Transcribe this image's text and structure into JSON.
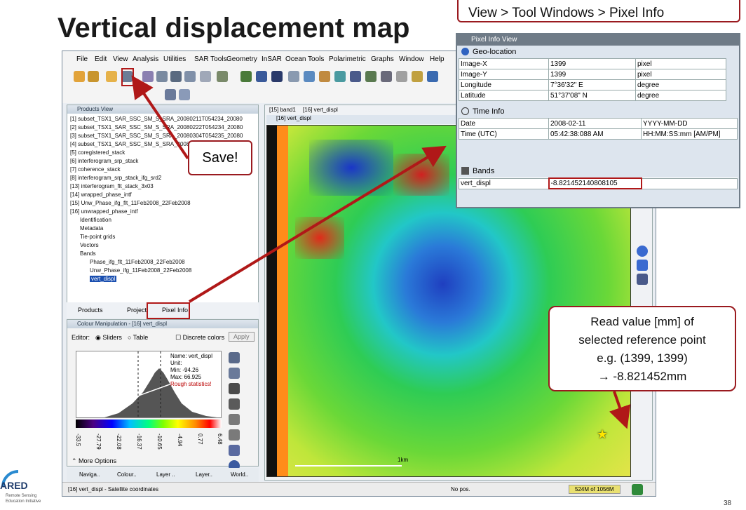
{
  "slide": {
    "title": "Vertical displacement map",
    "path_hint": "View > Tool Windows > Pixel Info",
    "save_callout": "Save!",
    "read_callout": [
      "Read value [mm] of",
      "selected reference point",
      "e.g. (1399, 1399)",
      "→ -8.821452mm"
    ],
    "page_number": "38",
    "logo_text": "ARED",
    "logo_sub": [
      "Remote Sensing",
      "Education Initiative"
    ]
  },
  "menu": [
    "File",
    "Edit",
    "View",
    "Analysis",
    "Utilities",
    "SAR Tools",
    "Geometry",
    "InSAR",
    "Ocean Tools",
    "Polarimetric",
    "Graphs",
    "Window",
    "Help"
  ],
  "products": {
    "header": "Products View",
    "items": [
      "[1] subset_TSX1_SAR_SSC_SM_S_SRA_20080211T054234_20080",
      "[2] subset_TSX1_SAR_SSC_SM_S_SRA_20080222T054234_20080",
      "[3] subset_TSX1_SAR_SSC_SM_S_SRA_20080304T054235_20080",
      "[4] subset_TSX1_SAR_SSC_SM_S_SRA_20080",
      "[5] coregistered_stack",
      "[6] interferogram_srp_stack",
      "[7] coherence_stack",
      "[8] interferogram_srp_stack_ifg_srd2",
      "[13] interferogram_flt_stack_3x03",
      "[14] wrapped_phase_intf",
      "[15] Unw_Phase_ifg_flt_11Feb2008_22Feb2008",
      "[16] unwrapped_phase_intf",
      "Identification",
      "Metadata",
      "Tie-point grids",
      "Vectors",
      "Bands",
      "Phase_ifg_flt_11Feb2008_22Feb2008",
      "Unw_Phase_ifg_11Feb2008_22Feb2008",
      "vert_displ"
    ],
    "tabs": [
      "Products",
      "Project",
      "Pixel Info"
    ]
  },
  "colour": {
    "header": "Colour Manipulation - [16] vert_displ",
    "editor_label": "Editor:",
    "sliders": "Sliders",
    "table": "Table",
    "discrete": "Discrete colors",
    "apply": "Apply",
    "name": "Name: vert_displ",
    "unit": "Unit:",
    "min": "Min: -94.26",
    "max": "Max: 66.925",
    "rough": "Rough statistics!",
    "ticks": [
      "-33.5",
      "-27.79",
      "-22.08",
      "-16.37",
      "-10.65",
      "-4.94",
      "0.77",
      "6.48"
    ],
    "more": "More Options",
    "bottom_tabs": [
      "Naviga..",
      "Colour..",
      "Layer ..",
      "Layer..",
      "World.."
    ]
  },
  "image": {
    "tabs": [
      "[15] band1",
      "[16] vert_displ"
    ],
    "view_title": "[16] vert_displ",
    "scale_label": "1km"
  },
  "status": {
    "left": "[16] vert_displ - Satellite coordinates",
    "pos": "No pos.",
    "mem": "524M of 1056M"
  },
  "pixel_info": {
    "title": "Pixel Info View",
    "geo_header": "Geo-location",
    "geo_rows": [
      [
        "Image-X",
        "1399",
        "pixel"
      ],
      [
        "Image-Y",
        "1399",
        "pixel"
      ],
      [
        "Longitude",
        "7°36'32\" E",
        "degree"
      ],
      [
        "Latitude",
        "51°37'08\" N",
        "degree"
      ]
    ],
    "time_header": "Time Info",
    "time_rows": [
      [
        "Date",
        "2008-02-11",
        "YYYY-MM-DD"
      ],
      [
        "Time (UTC)",
        "05:42:38:088 AM",
        "HH:MM:SS:mm [AM/PM]"
      ]
    ],
    "bands_header": "Bands",
    "band_name": "vert_displ",
    "band_value": "-8.821452140808105"
  },
  "colors": {
    "accent_red": "#9a1a1f",
    "panel_header": "#6f7b87"
  }
}
